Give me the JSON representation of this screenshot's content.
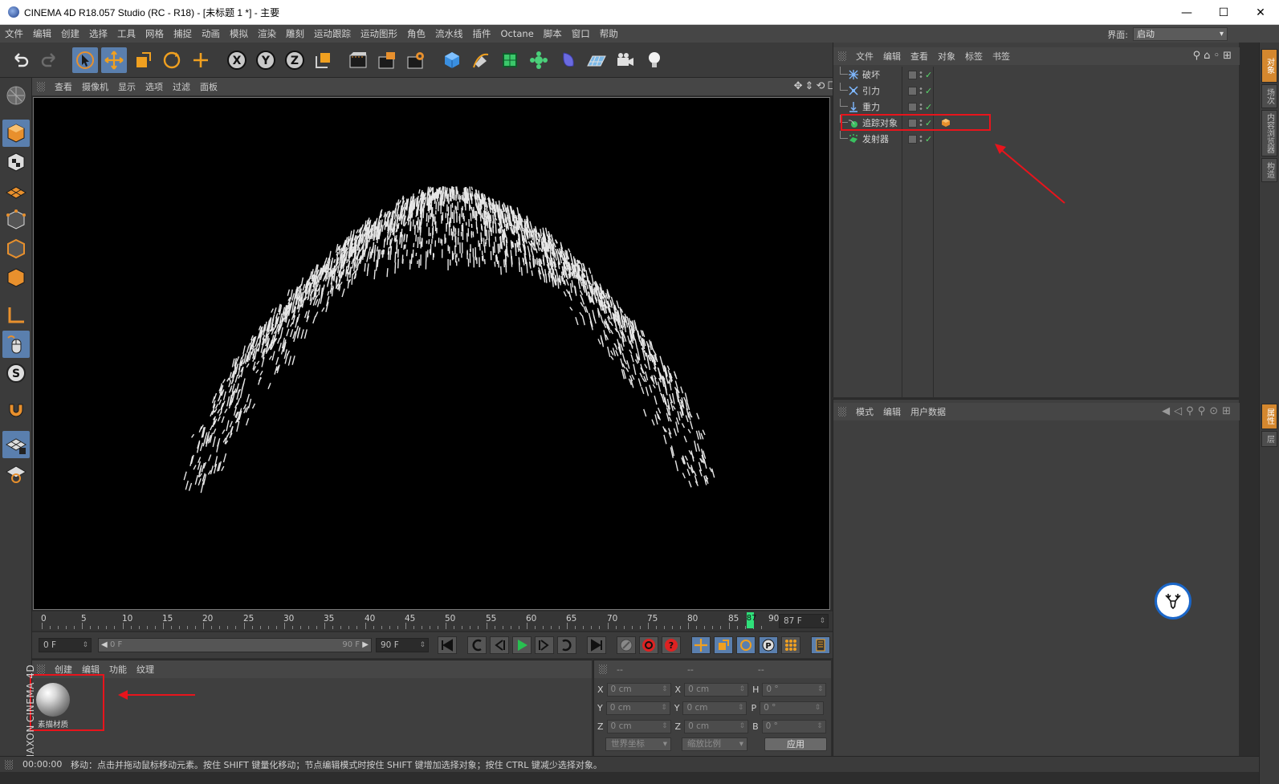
{
  "window": {
    "title": "CINEMA 4D R18.057 Studio (RC - R18) - [未标题 1 *] - 主要",
    "controls": {
      "minimize": "—",
      "maximize": "☐",
      "close": "✕"
    }
  },
  "menubar": {
    "items": [
      "文件",
      "编辑",
      "创建",
      "选择",
      "工具",
      "网格",
      "捕捉",
      "动画",
      "模拟",
      "渲染",
      "雕刻",
      "运动跟踪",
      "运动图形",
      "角色",
      "流水线",
      "插件",
      "Octane",
      "脚本",
      "窗口",
      "帮助"
    ],
    "layout_label": "界面:",
    "layout_value": "启动"
  },
  "right_sidebar_tabs": [
    "对象",
    "场次",
    "内容浏览器",
    "构造",
    "属性",
    "层"
  ],
  "viewport": {
    "menu": [
      "查看",
      "摄像机",
      "显示",
      "选项",
      "过滤",
      "面板"
    ],
    "nav_icons": "✥⇕⟲☐"
  },
  "timeline": {
    "ticks": [
      "0",
      "5",
      "10",
      "15",
      "20",
      "25",
      "30",
      "35",
      "40",
      "45",
      "50",
      "55",
      "60",
      "65",
      "70",
      "75",
      "80",
      "85",
      "90"
    ],
    "playhead_label": "87",
    "current_frame_field": "87 F"
  },
  "transport": {
    "start_field": "0 F",
    "range_start": "0 F",
    "range_end": "90 F",
    "end_field": "90 F"
  },
  "material_manager": {
    "menu": [
      "创建",
      "编辑",
      "功能",
      "纹理"
    ],
    "materials": [
      {
        "name": "素描材质"
      }
    ]
  },
  "coordinates": {
    "header": [
      "--",
      "--",
      "--"
    ],
    "rows": [
      {
        "a": "X",
        "a_val": "0 cm",
        "b": "X",
        "b_val": "0 cm",
        "c": "H",
        "c_val": "0 °"
      },
      {
        "a": "Y",
        "a_val": "0 cm",
        "b": "Y",
        "b_val": "0 cm",
        "c": "P",
        "c_val": "0 °"
      },
      {
        "a": "Z",
        "a_val": "0 cm",
        "b": "Z",
        "b_val": "0 cm",
        "c": "B",
        "c_val": "0 °"
      }
    ],
    "space_select": "世界坐标",
    "scale_select": "缩放比例",
    "apply": "应用"
  },
  "object_manager": {
    "menu": [
      "文件",
      "编辑",
      "查看",
      "对象",
      "标签",
      "书签"
    ],
    "tools": "⚲⌂◦⊞",
    "objects": [
      {
        "name": "破坏",
        "icon": "deflector"
      },
      {
        "name": "引力",
        "icon": "attractor"
      },
      {
        "name": "重力",
        "icon": "gravity"
      },
      {
        "name": "追踪对象",
        "icon": "tracer",
        "has_tag": true
      },
      {
        "name": "发射器",
        "icon": "emitter"
      }
    ]
  },
  "attribute_manager": {
    "menu": [
      "模式",
      "编辑",
      "用户数据"
    ],
    "tools": "◀◁⚲⚲⊙⊞"
  },
  "status": {
    "time": "00:00:00",
    "message": "移动：点击并拖动鼠标移动元素。按住 SHIFT 键量化移动；节点编辑模式时按住 SHIFT 键增加选择对象；按住 CTRL 键减少选择对象。"
  },
  "branding": {
    "maxon": "MAXON",
    "c4d": "CINEMA 4D"
  }
}
